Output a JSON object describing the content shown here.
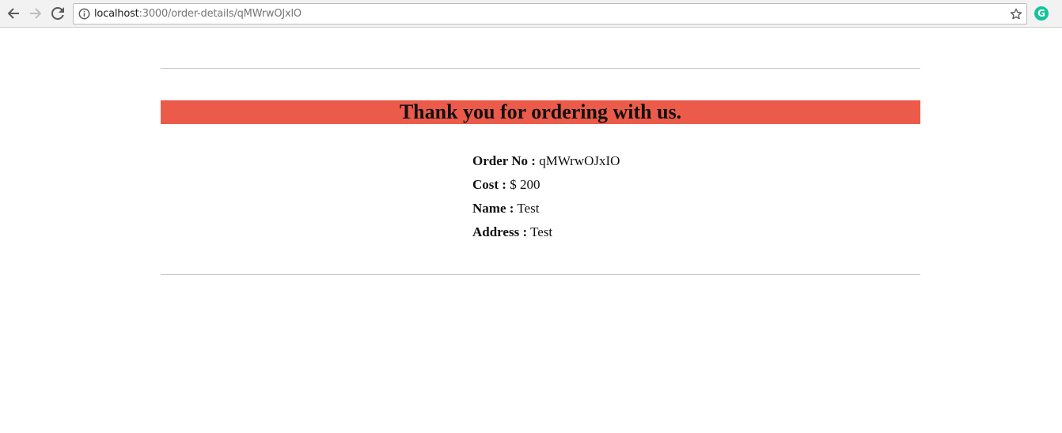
{
  "browser": {
    "url_host": "localhost",
    "url_path": ":3000/order-details/qMWrwOJxlO",
    "extension_letter": "G",
    "extension_color": "#15c39a"
  },
  "banner": {
    "title": "Thank you for ordering with us.",
    "background": "#ec5b4a"
  },
  "order": {
    "rows": [
      {
        "label": "Order No :",
        "value": "qMWrwOJxIO"
      },
      {
        "label": "Cost :",
        "value": "$ 200"
      },
      {
        "label": "Name :",
        "value": "Test"
      },
      {
        "label": "Address :",
        "value": "Test"
      }
    ]
  }
}
